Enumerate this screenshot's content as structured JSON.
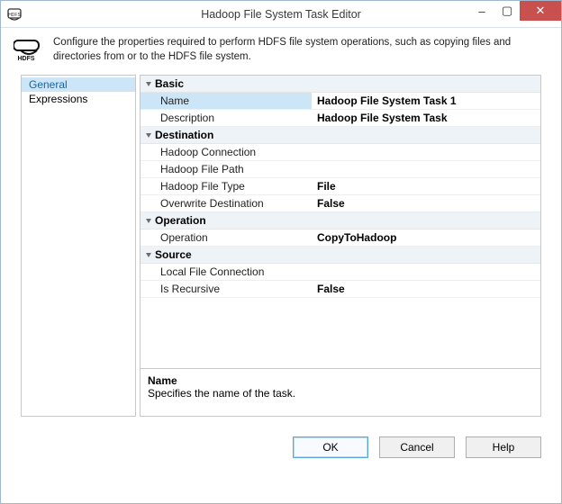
{
  "window": {
    "title": "Hadoop File System Task Editor",
    "icon_label": "HDFS",
    "minimize": "–",
    "maximize": "▢",
    "close": "✕"
  },
  "header": {
    "description": "Configure the properties required to perform HDFS file system operations, such as copying files and directories from or to the HDFS file system."
  },
  "nav": {
    "items": [
      {
        "label": "General",
        "selected": true
      },
      {
        "label": "Expressions",
        "selected": false
      }
    ]
  },
  "grid": {
    "categories": [
      {
        "name": "Basic",
        "rows": [
          {
            "label": "Name",
            "value": "Hadoop File System Task 1",
            "selected": true
          },
          {
            "label": "Description",
            "value": "Hadoop File System Task"
          }
        ]
      },
      {
        "name": "Destination",
        "rows": [
          {
            "label": "Hadoop Connection",
            "value": ""
          },
          {
            "label": "Hadoop File Path",
            "value": ""
          },
          {
            "label": "Hadoop File Type",
            "value": "File"
          },
          {
            "label": "Overwrite Destination",
            "value": "False"
          }
        ]
      },
      {
        "name": "Operation",
        "rows": [
          {
            "label": "Operation",
            "value": "CopyToHadoop"
          }
        ]
      },
      {
        "name": "Source",
        "rows": [
          {
            "label": "Local File Connection",
            "value": ""
          },
          {
            "label": "Is Recursive",
            "value": "False"
          }
        ]
      }
    ]
  },
  "help": {
    "title": "Name",
    "desc": "Specifies the name of the task."
  },
  "buttons": {
    "ok": "OK",
    "cancel": "Cancel",
    "help": "Help"
  }
}
